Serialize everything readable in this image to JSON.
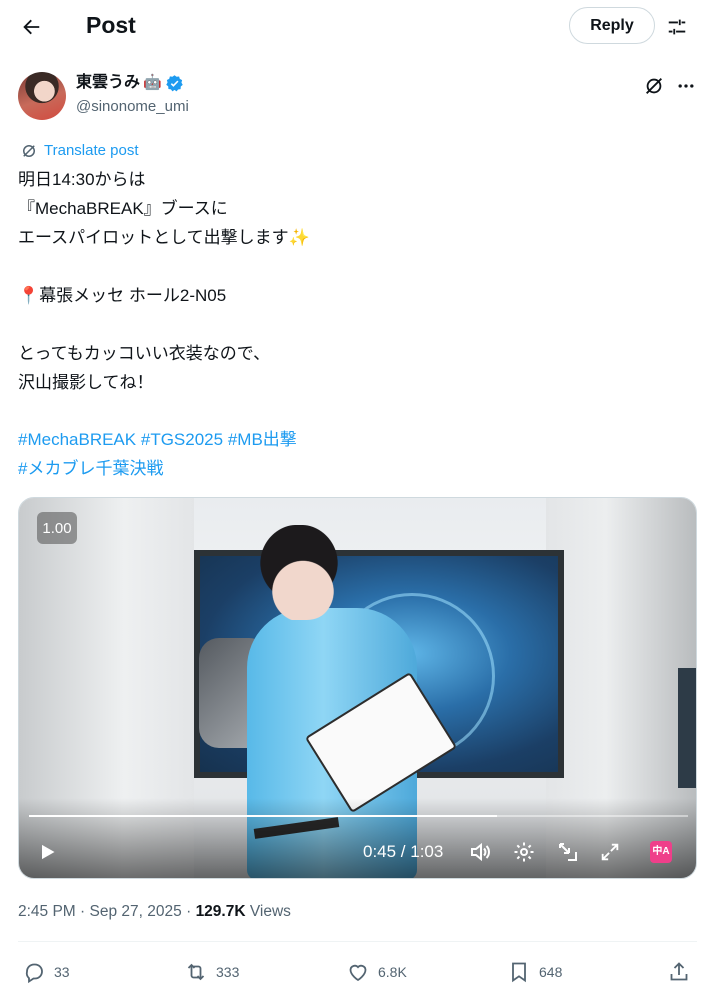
{
  "header": {
    "title": "Post",
    "reply_label": "Reply"
  },
  "author": {
    "name": "東雲うみ",
    "name_emoji": "🤖",
    "handle": "@sinonome_umi"
  },
  "translate_label": "Translate post",
  "post_lines": [
    "明日14:30からは",
    "『MechaBREAK』ブースに",
    "エースパイロットとして出撃します",
    "📍幕張メッセ ホール2-N05",
    "とってもカッコいい衣装なので、",
    "沢山撮影してね！"
  ],
  "sparkle_emoji": "✨",
  "hashtags": [
    "#MechaBREAK",
    "#TGS2025",
    "#MB出撃",
    "#メカブレ千葉決戦"
  ],
  "video": {
    "rate": "1.00",
    "time": "0:45 / 1:03",
    "progress": 0.71,
    "cc_label": "中A"
  },
  "meta": {
    "time": "2:45 PM",
    "date": "Sep 27, 2025",
    "views_count": "129.7K",
    "views_label": "Views",
    "sep": "·"
  },
  "actions": {
    "replies": "33",
    "reposts": "333",
    "likes": "6.8K",
    "bookmarks": "648"
  },
  "colors": {
    "accent": "#1d9bf0",
    "text": "#0f1419",
    "muted": "#536471"
  }
}
